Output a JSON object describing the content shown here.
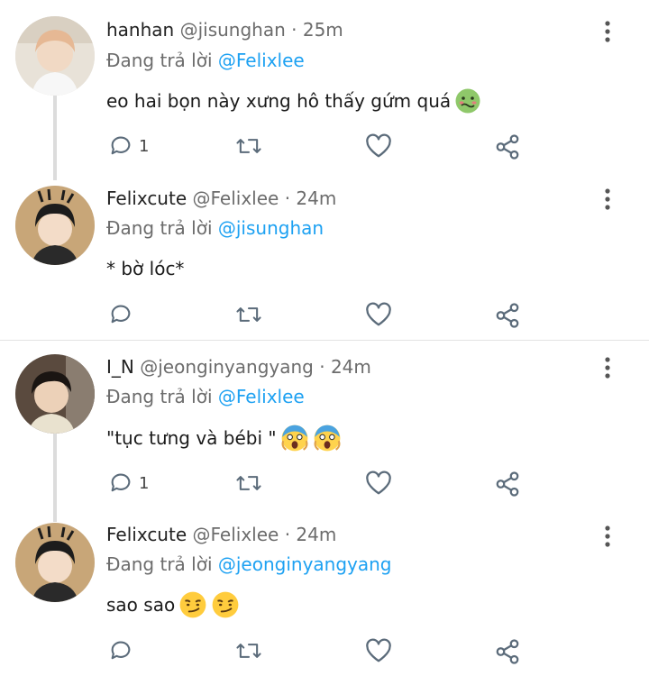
{
  "tweets": [
    {
      "name": "hanhan",
      "handle": "@jisunghan",
      "sep": "·",
      "time": "25m",
      "replying_prefix": "Đang trả lời",
      "replying_to": "@Felixlee",
      "text": "eo hai bọn này xưng hô thấy gứm quá",
      "emoji": [
        "nauseated-face"
      ],
      "reply_count": "1"
    },
    {
      "name": "Felixcute",
      "handle": "@Felixlee",
      "sep": "·",
      "time": "24m",
      "replying_prefix": "Đang trả lời",
      "replying_to": "@jisunghan",
      "text": "* bờ lóc*",
      "emoji": [],
      "reply_count": ""
    },
    {
      "name": "I_N",
      "handle": "@jeonginyangyang",
      "sep": "·",
      "time": "24m",
      "replying_prefix": "Đang trả lời",
      "replying_to": "@Felixlee",
      "text": "\"tục tưng và bébi \"",
      "emoji": [
        "screaming-face",
        "screaming-face"
      ],
      "reply_count": "1"
    },
    {
      "name": "Felixcute",
      "handle": "@Felixlee",
      "sep": "·",
      "time": "24m",
      "replying_prefix": "Đang trả lời",
      "replying_to": "@jeonginyangyang",
      "text": "sao sao",
      "emoji": [
        "smirking-face",
        "smirking-face"
      ],
      "reply_count": ""
    }
  ],
  "colors": {
    "mention": "#1da1f2",
    "icon": "#5b6b7a",
    "thread_line": "#dcdcdc"
  }
}
